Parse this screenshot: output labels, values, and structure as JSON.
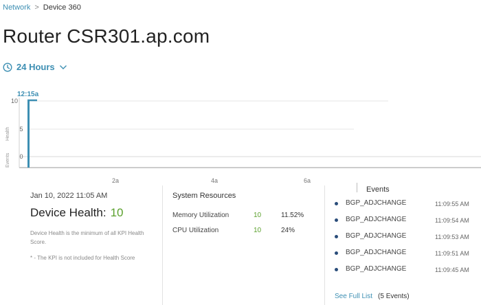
{
  "breadcrumb": {
    "parent": "Network",
    "current": "Device 360"
  },
  "page": {
    "title": "Router CSR301.ap.com"
  },
  "time_range": {
    "label": "24 Hours"
  },
  "timeline": {
    "cursor_label": "12:15a",
    "y_axis_label_1": "Health",
    "y_axis_label_2": "Events",
    "y_ticks": [
      "10",
      "5",
      "0"
    ],
    "x_ticks": [
      "2a",
      "4a",
      "6a"
    ],
    "accent_color": "#3d8fb3"
  },
  "device_health": {
    "date": "Jan 10, 2022 11:05 AM",
    "label": "Device Health:",
    "score": "10",
    "note_1": "Device Health is the minimum of all KPI Health Score.",
    "note_2": "* - The KPI is not included for Health Score"
  },
  "system_resources": {
    "title": "System Resources",
    "rows": [
      {
        "name": "Memory Utilization",
        "score": "10",
        "value": "11.52%"
      },
      {
        "name": "CPU Utilization",
        "score": "10",
        "value": "24%"
      }
    ]
  },
  "events": {
    "title": "Events",
    "items": [
      {
        "name": "BGP_ADJCHANGE",
        "time": "11:09:55 AM"
      },
      {
        "name": "BGP_ADJCHANGE",
        "time": "11:09:54 AM"
      },
      {
        "name": "BGP_ADJCHANGE",
        "time": "11:09:53 AM"
      },
      {
        "name": "BGP_ADJCHANGE",
        "time": "11:09:51 AM"
      },
      {
        "name": "BGP_ADJCHANGE",
        "time": "11:09:45 AM"
      }
    ],
    "see_full_label": "See Full List",
    "count_label": "(5 Events)"
  },
  "colors": {
    "link": "#3d8fb3",
    "good_score": "#5aa02c",
    "event_dot": "#2a4d7a"
  }
}
